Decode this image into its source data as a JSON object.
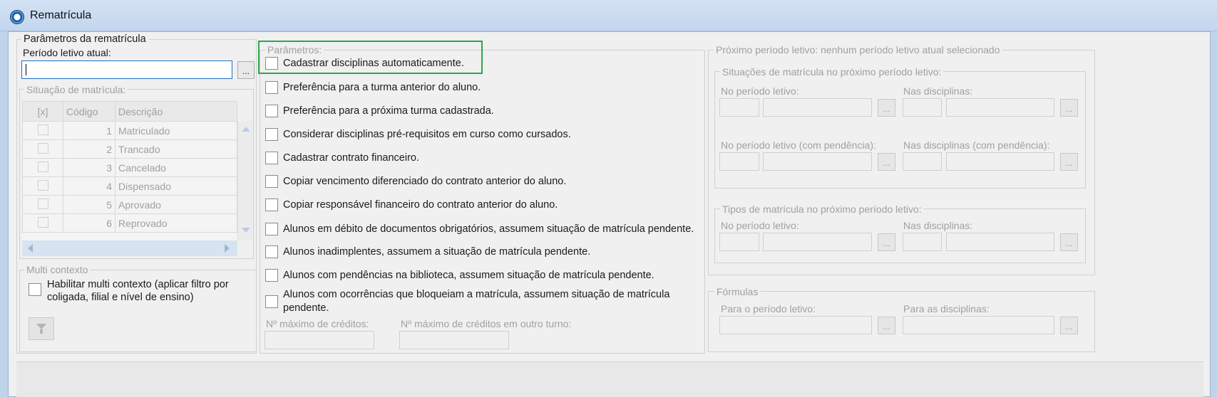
{
  "window": {
    "title": "Rematrícula"
  },
  "left": {
    "section_title": "Parâmetros da rematrícula",
    "period_label": "Período letivo atual:",
    "period_value": "",
    "ellipsis": "...",
    "situation_group": "Situação de matrícula:",
    "columns": [
      "[x]",
      "Código",
      "Descrição"
    ],
    "rows": [
      {
        "code": "1",
        "desc": "Matriculado"
      },
      {
        "code": "2",
        "desc": "Trancado"
      },
      {
        "code": "3",
        "desc": "Cancelado"
      },
      {
        "code": "4",
        "desc": "Dispensado"
      },
      {
        "code": "5",
        "desc": "Aprovado"
      },
      {
        "code": "6",
        "desc": "Reprovado"
      }
    ],
    "multi_group": "Multi contexto",
    "multi_label_line1": "Habilitar multi contexto (aplicar filtro por",
    "multi_label_line2": "coligada, filial e nível de ensino)"
  },
  "params": {
    "group": "Parâmetros:",
    "options": [
      "Cadastrar disciplinas automaticamente.",
      "Preferência para a turma anterior do aluno.",
      "Preferência para a próxima turma cadastrada.",
      "Considerar disciplinas pré-requisitos em curso como cursados.",
      "Cadastrar contrato financeiro.",
      "Copiar vencimento diferenciado do contrato anterior do aluno.",
      "Copiar responsável financeiro do contrato anterior do aluno.",
      "Alunos em débito de documentos obrigatórios, assumem situação de matrícula pendente.",
      "Alunos inadimplentes, assumem a situação de matrícula pendente.",
      "Alunos com pendências na biblioteca, assumem situação de matrícula pendente."
    ],
    "last_option_line1": "Alunos com ocorrências que bloqueiam a matrícula, assumem situação de matrícula",
    "last_option_line2": "pendente.",
    "max_credits": "Nº máximo de créditos:",
    "max_credits_other": "Nº máximo de créditos em outro turno:"
  },
  "next": {
    "group": "Próximo período letivo: nenhum período letivo atual selecionado",
    "situations_group": "Situações de matrícula no próximo período letivo:",
    "no_periodo": "No período letivo:",
    "nas_disciplinas": "Nas disciplinas:",
    "no_periodo_pend": "No período letivo (com pendência):",
    "nas_disciplinas_pend": "Nas disciplinas (com pendência):",
    "types_group": "Tipos de matrícula no próximo período letivo:",
    "formulas_group": "Fórmulas",
    "para_periodo": "Para o período letivo:",
    "para_disciplinas": "Para as disciplinas:"
  },
  "colors": {
    "highlight": "#2aa84a",
    "accent": "#1f5fa8"
  }
}
